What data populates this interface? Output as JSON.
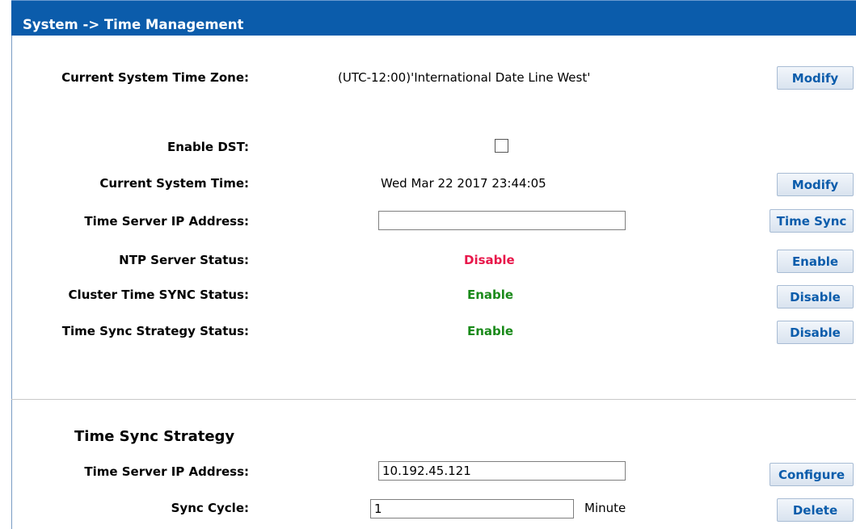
{
  "header": {
    "title": "System -> Time Management"
  },
  "timezone": {
    "label": "Current System Time Zone:",
    "value": "(UTC-12:00)'International Date Line West'",
    "button": "Modify"
  },
  "dst": {
    "label": "Enable DST:",
    "checked": false
  },
  "system_time": {
    "label": "Current System Time:",
    "value": "Wed Mar 22 2017 23:44:05",
    "button": "Modify"
  },
  "time_server": {
    "label": "Time Server IP Address:",
    "value": "",
    "button": "Time Sync"
  },
  "ntp": {
    "label": "NTP Server Status:",
    "value": "Disable",
    "button": "Enable"
  },
  "cluster_sync": {
    "label": "Cluster Time SYNC Status:",
    "value": "Enable",
    "button": "Disable"
  },
  "strategy_status": {
    "label": "Time Sync Strategy Status:",
    "value": "Enable",
    "button": "Disable"
  },
  "strategy": {
    "title": "Time Sync Strategy",
    "server_label": "Time Server IP Address:",
    "server_value": "10.192.45.121",
    "configure_button": "Configure",
    "cycle_label": "Sync Cycle:",
    "cycle_value": "1",
    "cycle_unit": "Minute",
    "delete_button": "Delete"
  },
  "colors": {
    "header_bg": "#0b5cab",
    "status_disable": "#e8174a",
    "status_enable": "#1a8a1a",
    "button_text": "#0b5cab"
  }
}
